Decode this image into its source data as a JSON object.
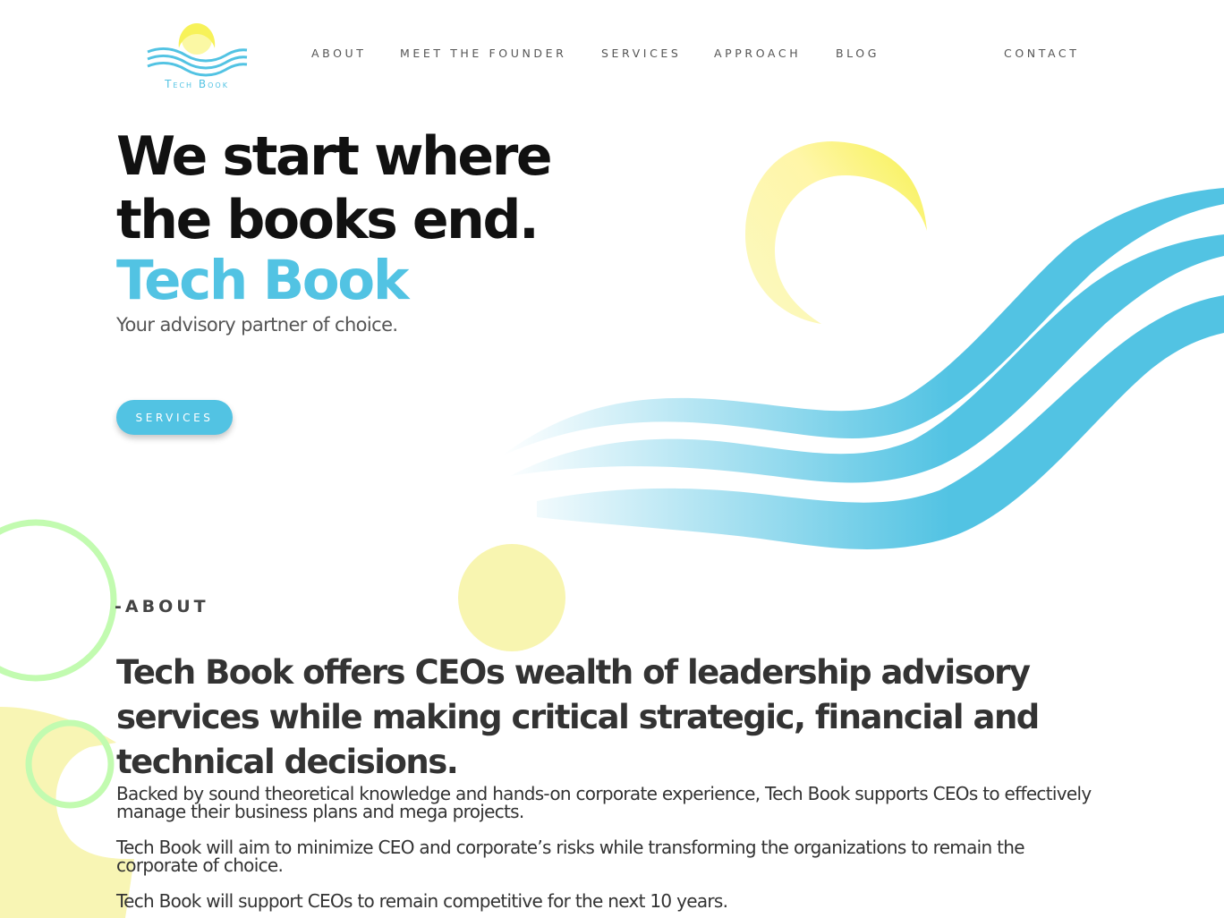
{
  "header": {
    "logo_text": "Tech Book",
    "nav": [
      {
        "label": "ABOUT"
      },
      {
        "label": "MEET THE FOUNDER"
      },
      {
        "label": "SERVICES"
      },
      {
        "label": "APPROACH"
      },
      {
        "label": "BLOG"
      },
      {
        "label": "CONTACT"
      }
    ]
  },
  "hero": {
    "title": "We start where the books end.",
    "brand": "Tech Book",
    "subtitle": "Your advisory partner of choice.",
    "cta_label": "SERVICES"
  },
  "about": {
    "label": "-ABOUT",
    "heading": "Tech Book offers CEOs wealth of leadership advisory services while making critical strategic, financial and technical decisions.",
    "paragraphs": [
      "Backed by sound theoretical knowledge and hands-on corporate experience, Tech Book supports CEOs to effectively manage their business plans and mega projects.",
      "Tech Book will aim to minimize CEO and corporate’s risks while transforming the organizations to remain the corporate of choice.",
      "Tech Book will support CEOs to remain competitive for the next 10 years."
    ]
  },
  "colors": {
    "accent_blue": "#52c3e3",
    "sun_yellow": "#f7f39a",
    "ring_green": "#c2fbb0"
  }
}
